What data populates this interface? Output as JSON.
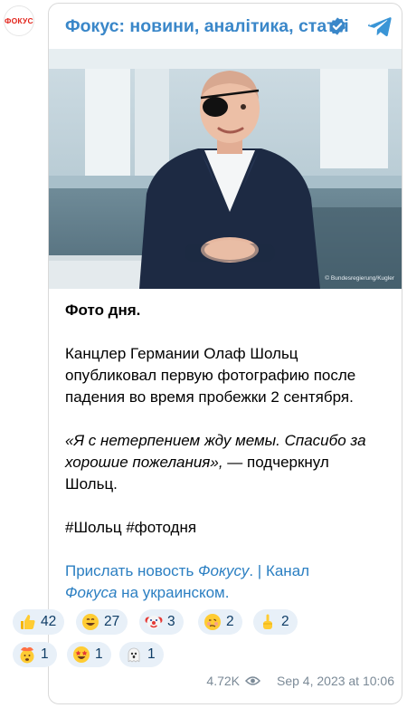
{
  "avatar": {
    "text": "ФОКУС",
    "color": "#e2231a"
  },
  "header": {
    "channel_name": "Фокус: новини, аналітика, статті",
    "verified_icon": "verified-check-icon",
    "share_icon": "telegram-icon",
    "accent": "#3a87c9"
  },
  "photo": {
    "credit": "© Bundesregierung/Kugler"
  },
  "post": {
    "title": "Фото дня.",
    "para1_line1": "Канцлер Германии Олаф Шольц",
    "para1_line2": "опубликовал первую фотографию после",
    "para1_line3": "падения во время пробежки 2 сентября.",
    "quote_line1": "«Я с нетерпением жду мемы. Спасибо за",
    "quote_line2_italic": "хорошие пожелания»,",
    "quote_line2_rest": " — подчеркнул",
    "quote_line3": "Шольц.",
    "hashtags": "#Шольц #фотодня",
    "links_line1_a": "Прислать новость ",
    "links_line1_b": "Фокусу",
    "links_line1_c": ". | Канал",
    "links_line2_a": "Фокуса",
    "links_line2_b": " на украинском."
  },
  "reactions": [
    {
      "emoji": "thumbs-up-icon",
      "count": "42"
    },
    {
      "emoji": "grinning-face-icon",
      "count": "27"
    },
    {
      "emoji": "clown-face-icon",
      "count": "3"
    },
    {
      "emoji": "woozy-face-icon",
      "count": "2"
    },
    {
      "emoji": "middle-finger-icon",
      "count": "2"
    },
    {
      "emoji": "exploding-head-icon",
      "count": "1"
    },
    {
      "emoji": "star-struck-icon",
      "count": "1"
    },
    {
      "emoji": "ghost-icon",
      "count": "1"
    }
  ],
  "footer": {
    "views": "4.72K",
    "date": "Sep 4, 2023 at 10:06",
    "views_icon": "eye-icon"
  }
}
